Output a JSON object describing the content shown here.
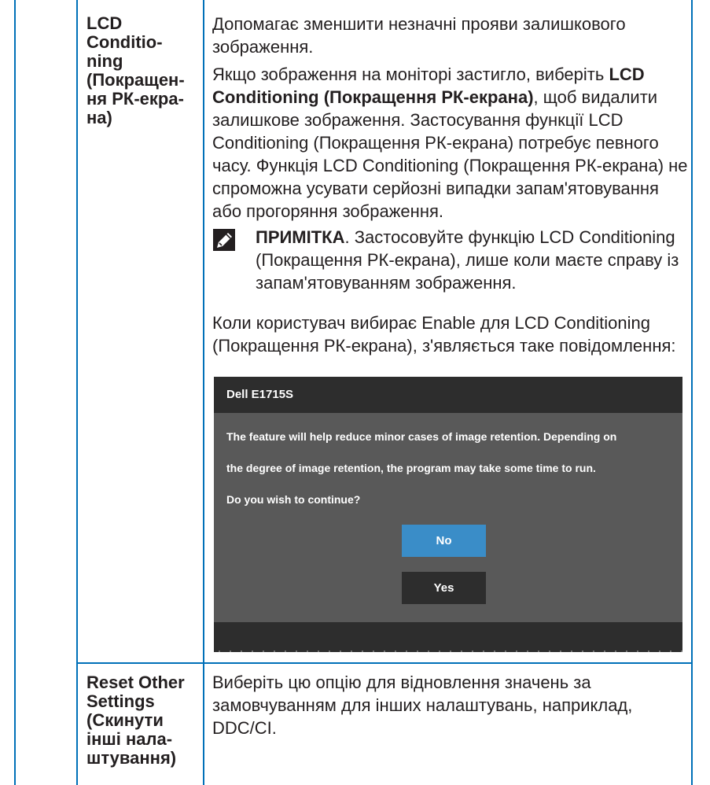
{
  "row1": {
    "label_lines": [
      "LCD",
      "Conditio-",
      "ning",
      "(Покращен-",
      "ня РК-екра-",
      "на)"
    ],
    "para1": "Допомагає зменшити незначні прояви залишкового зображення.",
    "para2_prefix": "Якщо зображення на моніторі застигло, виберіть ",
    "para2_bold": "LCD Conditioning (Покращення РК-екрана)",
    "para2_suffix": ", щоб видалити залишкове зображення. Застосування функції LCD Conditioning (Покращення РК-екрана) потребує певного часу. Функція LCD Conditioning (Покращення РК-екрана) не спроможна усувати серйозні випадки запам'ятовування або прогоряння зображення.",
    "note_label": "ПРИМІТКА",
    "note_text": ". Застосовуйте функцію LCD Conditioning (Покращення РК-екрана), лише коли маєте справу із запам'ятовуванням зображення.",
    "note_icon": "pencil-note-icon",
    "para3": "Коли користувач вибирає Enable для LCD Conditioning (Покращення РК-екрана), з'являється таке повідомлення:"
  },
  "osd": {
    "title": "Dell E1715S",
    "line1": "The feature will help reduce minor cases of image retention. Depending on",
    "line2": "the degree of image retention, the program may take some time to run.",
    "line3": "Do you wish to continue?",
    "btn_no": "No",
    "btn_yes": "Yes",
    "colors": {
      "panel": "#595959",
      "titlebar": "#2d2d2d",
      "btn_no": "#3a8dc8",
      "btn_yes": "#2d2d2d"
    }
  },
  "row2": {
    "label_lines": [
      "Reset Other",
      "Settings",
      "(Скинути",
      "інші нала-",
      "штування)"
    ],
    "text": "Виберіть цю опцію для відновлення значень за замовчуванням для інших налаштувань, наприклад, DDC/CI."
  },
  "colors": {
    "rule": "#0070b8",
    "text": "#231f20"
  }
}
